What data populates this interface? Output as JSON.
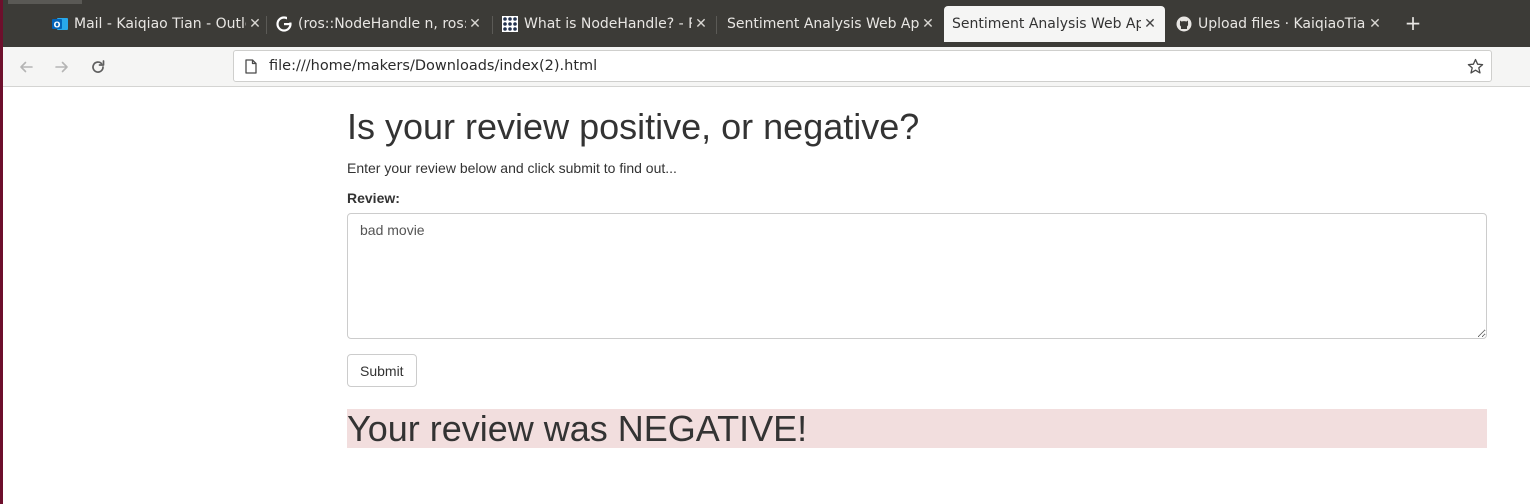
{
  "browser": {
    "tabs": [
      {
        "title": "Mail - Kaiqiao Tian - Outlook",
        "icon": "outlook-icon",
        "active": false
      },
      {
        "title": "(ros::NodeHandle n, ros::NodeHandle",
        "icon": "google-icon",
        "active": false
      },
      {
        "title": "What is NodeHandle? - ROS Answers",
        "icon": "ros-icon",
        "active": false
      },
      {
        "title": "Sentiment Analysis Web App",
        "icon": "none",
        "active": false
      },
      {
        "title": "Sentiment Analysis Web App",
        "icon": "none",
        "active": true
      },
      {
        "title": "Upload files · KaiqiaoTian",
        "icon": "github-icon",
        "active": false
      }
    ],
    "close_glyph": "✕",
    "new_tab_glyph": "+",
    "url": "file:///home/makers/Downloads/index(2).html"
  },
  "page": {
    "heading": "Is your review positive, or negative?",
    "subtitle": "Enter your review below and click submit to find out...",
    "review_label": "Review:",
    "review_value": "bad movie",
    "submit_label": "Submit",
    "result_text": "Your review was NEGATIVE!",
    "result_bg_color": "#f2dede"
  }
}
